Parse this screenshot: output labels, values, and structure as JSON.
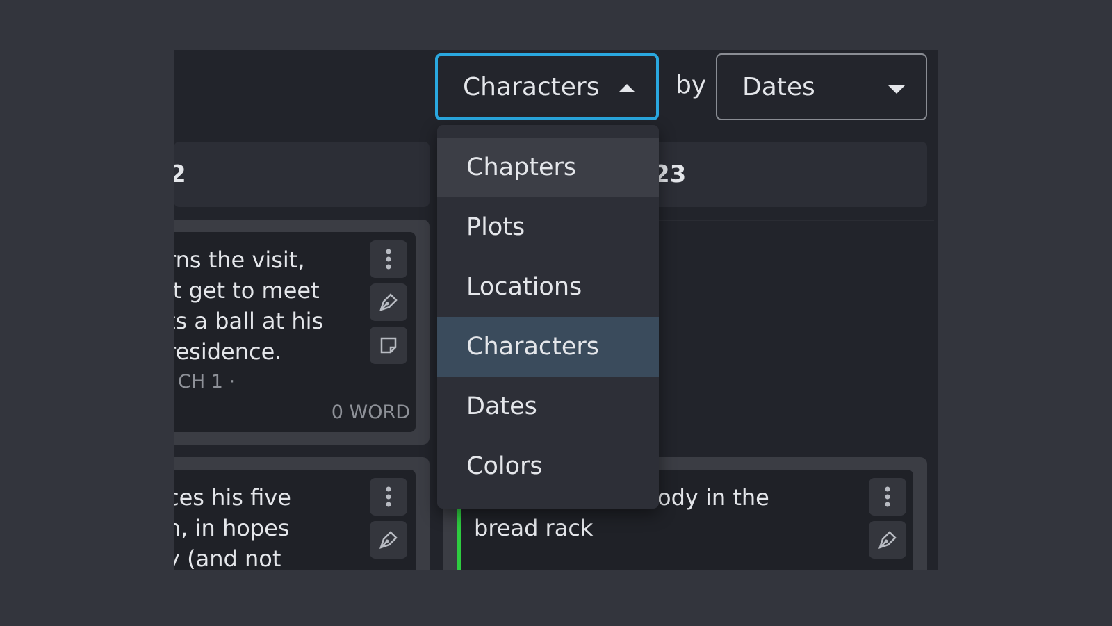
{
  "toolbar": {
    "group_by": "Characters",
    "by_label": "by",
    "sort_by": "Dates"
  },
  "dropdown": {
    "options": [
      "Chapters",
      "Plots",
      "Locations",
      "Characters",
      "Dates",
      "Colors"
    ],
    "selected": "Characters",
    "highlighted": "Chapters"
  },
  "columns": {
    "left_header": "2",
    "right_header": "23"
  },
  "cards": {
    "left_top": {
      "lines": [
        "rns the visit,",
        "'t get to meet",
        "ts a ball at his",
        "residence."
      ],
      "chapter": "CH 1 ·",
      "word_count": "0 WORD"
    },
    "left_bottom": {
      "lines": [
        "ces his five",
        "n, in hopes",
        "y (and not"
      ]
    },
    "right_bottom": {
      "lines": [
        "ody in the",
        "bread rack"
      ]
    }
  },
  "colors": {
    "accent": "#2aa8e0",
    "card_marker": "#2ecc40"
  }
}
